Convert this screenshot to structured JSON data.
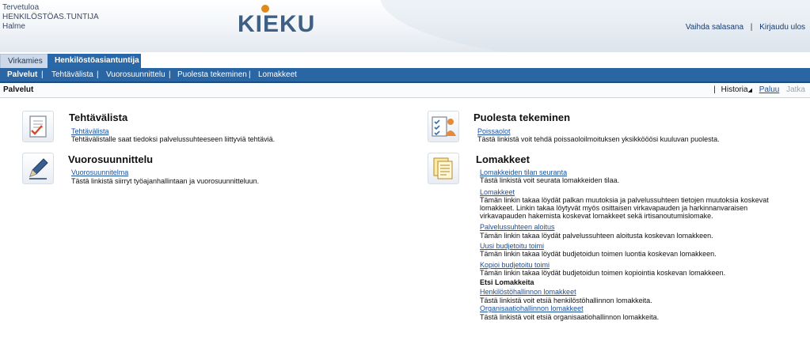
{
  "header": {
    "welcome": "Tervetuloa",
    "role": "HENKILÖSTÖAS.TUNTIJA",
    "user": "Halme",
    "logo": "KIEKU",
    "change_password": "Vaihda salasana",
    "separator": "|",
    "logout": "Kirjaudu ulos"
  },
  "role_tabs": [
    "Virkamies",
    "Henkilöstöasiantuntija"
  ],
  "nav": {
    "items": [
      "Palvelut",
      "Tehtävälista",
      "Vuorosuunnittelu",
      "Puolesta tekeminen",
      "Lomakkeet"
    ],
    "separator": "|"
  },
  "breadcrumb": {
    "title": "Palvelut",
    "history": "Historia",
    "back": "Paluu",
    "next": "Jatka"
  },
  "sections": {
    "tehtavalista": {
      "title": "Tehtävälista",
      "icon": "task-list-icon",
      "link": "Tehtävälista",
      "desc": "Tehtävälistalle saat tiedoksi palvelussuhteeseen liittyviä tehtäviä."
    },
    "vuorosuunnittelu": {
      "title": "Vuorosuunnittelu",
      "icon": "pencil-icon",
      "link": "Vuorosuunnitelma",
      "desc": "Tästä linkistä siirryt työajanhallintaan ja vuorosuunnitteluun."
    },
    "puolesta": {
      "title": "Puolesta tekeminen",
      "icon": "checklist-person-icon",
      "link": "Poissaolot",
      "desc": "Tästä linkistä voit tehdä poissaoloilmoituksen yksikkööösi kuuluvan puolesta."
    },
    "lomakkeet": {
      "title": "Lomakkeet",
      "icon": "forms-icon",
      "entries": [
        {
          "link": "Lomakkeiden tilan seuranta",
          "desc": "Tästä linkistä voit seurata lomakkeiden tilaa."
        },
        {
          "link": "Lomakkeet",
          "desc": "Tämän linkin takaa löydät palkan muutoksia ja palvelussuhteen tietojen muutoksia koskevat lomakkeet. Linkin takaa löytyvät myös osittaisen virkavapauden ja harkinnanvaraisen virkavapauden hakemista koskevat lomakkeet sekä irtisanoutumislomake."
        },
        {
          "link": "Palvelussuhteen aloitus",
          "desc": "Tämän linkin takaa löydät palvelussuhteen aloitusta koskevan lomakkeen."
        },
        {
          "link": "Uusi budjetoitu toimi",
          "desc": "Tämän linkin takaa löydät budjetoidun toimen luontia koskevan lomakkeen."
        },
        {
          "link": "Kopioi budjetoitu toimi",
          "desc": "Tämän linkin takaa löydät budjetoidun toimen kopiointia koskevan lomakkeen."
        }
      ],
      "search_title": "Etsi Lomakkeita",
      "search_entries": [
        {
          "link": "Henkilöstöhallinnon lomakkeet",
          "desc": "Tästä linkistä voit etsiä henkilöstöhallinnon lomakkeita."
        },
        {
          "link": "Organisaatiohallinnon lomakkeet",
          "desc": "Tästä linkistä voit etsiä organisaatiohallinnon lomakkeita."
        }
      ]
    }
  }
}
